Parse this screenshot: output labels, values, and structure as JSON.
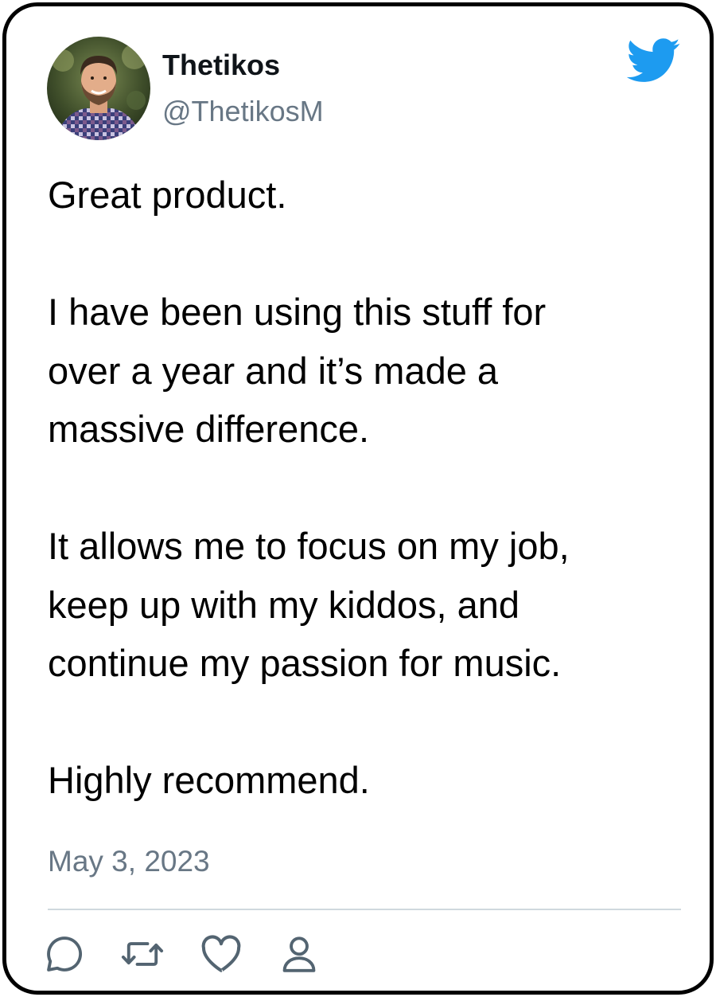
{
  "tweet": {
    "author": {
      "display_name": "Thetikos",
      "handle": "@ThetikosM"
    },
    "paragraphs": [
      "Great product.",
      "I have been using this stuff for\nover a year and it’s made a\nmassive difference.",
      "It allows me to focus on my job,\nkeep up with my kiddos, and\ncontinue my passion for music.",
      "Highly recommend."
    ],
    "date": "May 3, 2023"
  },
  "icons": {
    "brand": "twitter-bird-icon",
    "actions": [
      "reply-icon",
      "retweet-icon",
      "like-icon",
      "profile-icon"
    ]
  },
  "colors": {
    "twitter_blue": "#1d9bf0",
    "secondary_text": "#687785",
    "action_icon": "#536471",
    "divider": "#cfd9de"
  }
}
